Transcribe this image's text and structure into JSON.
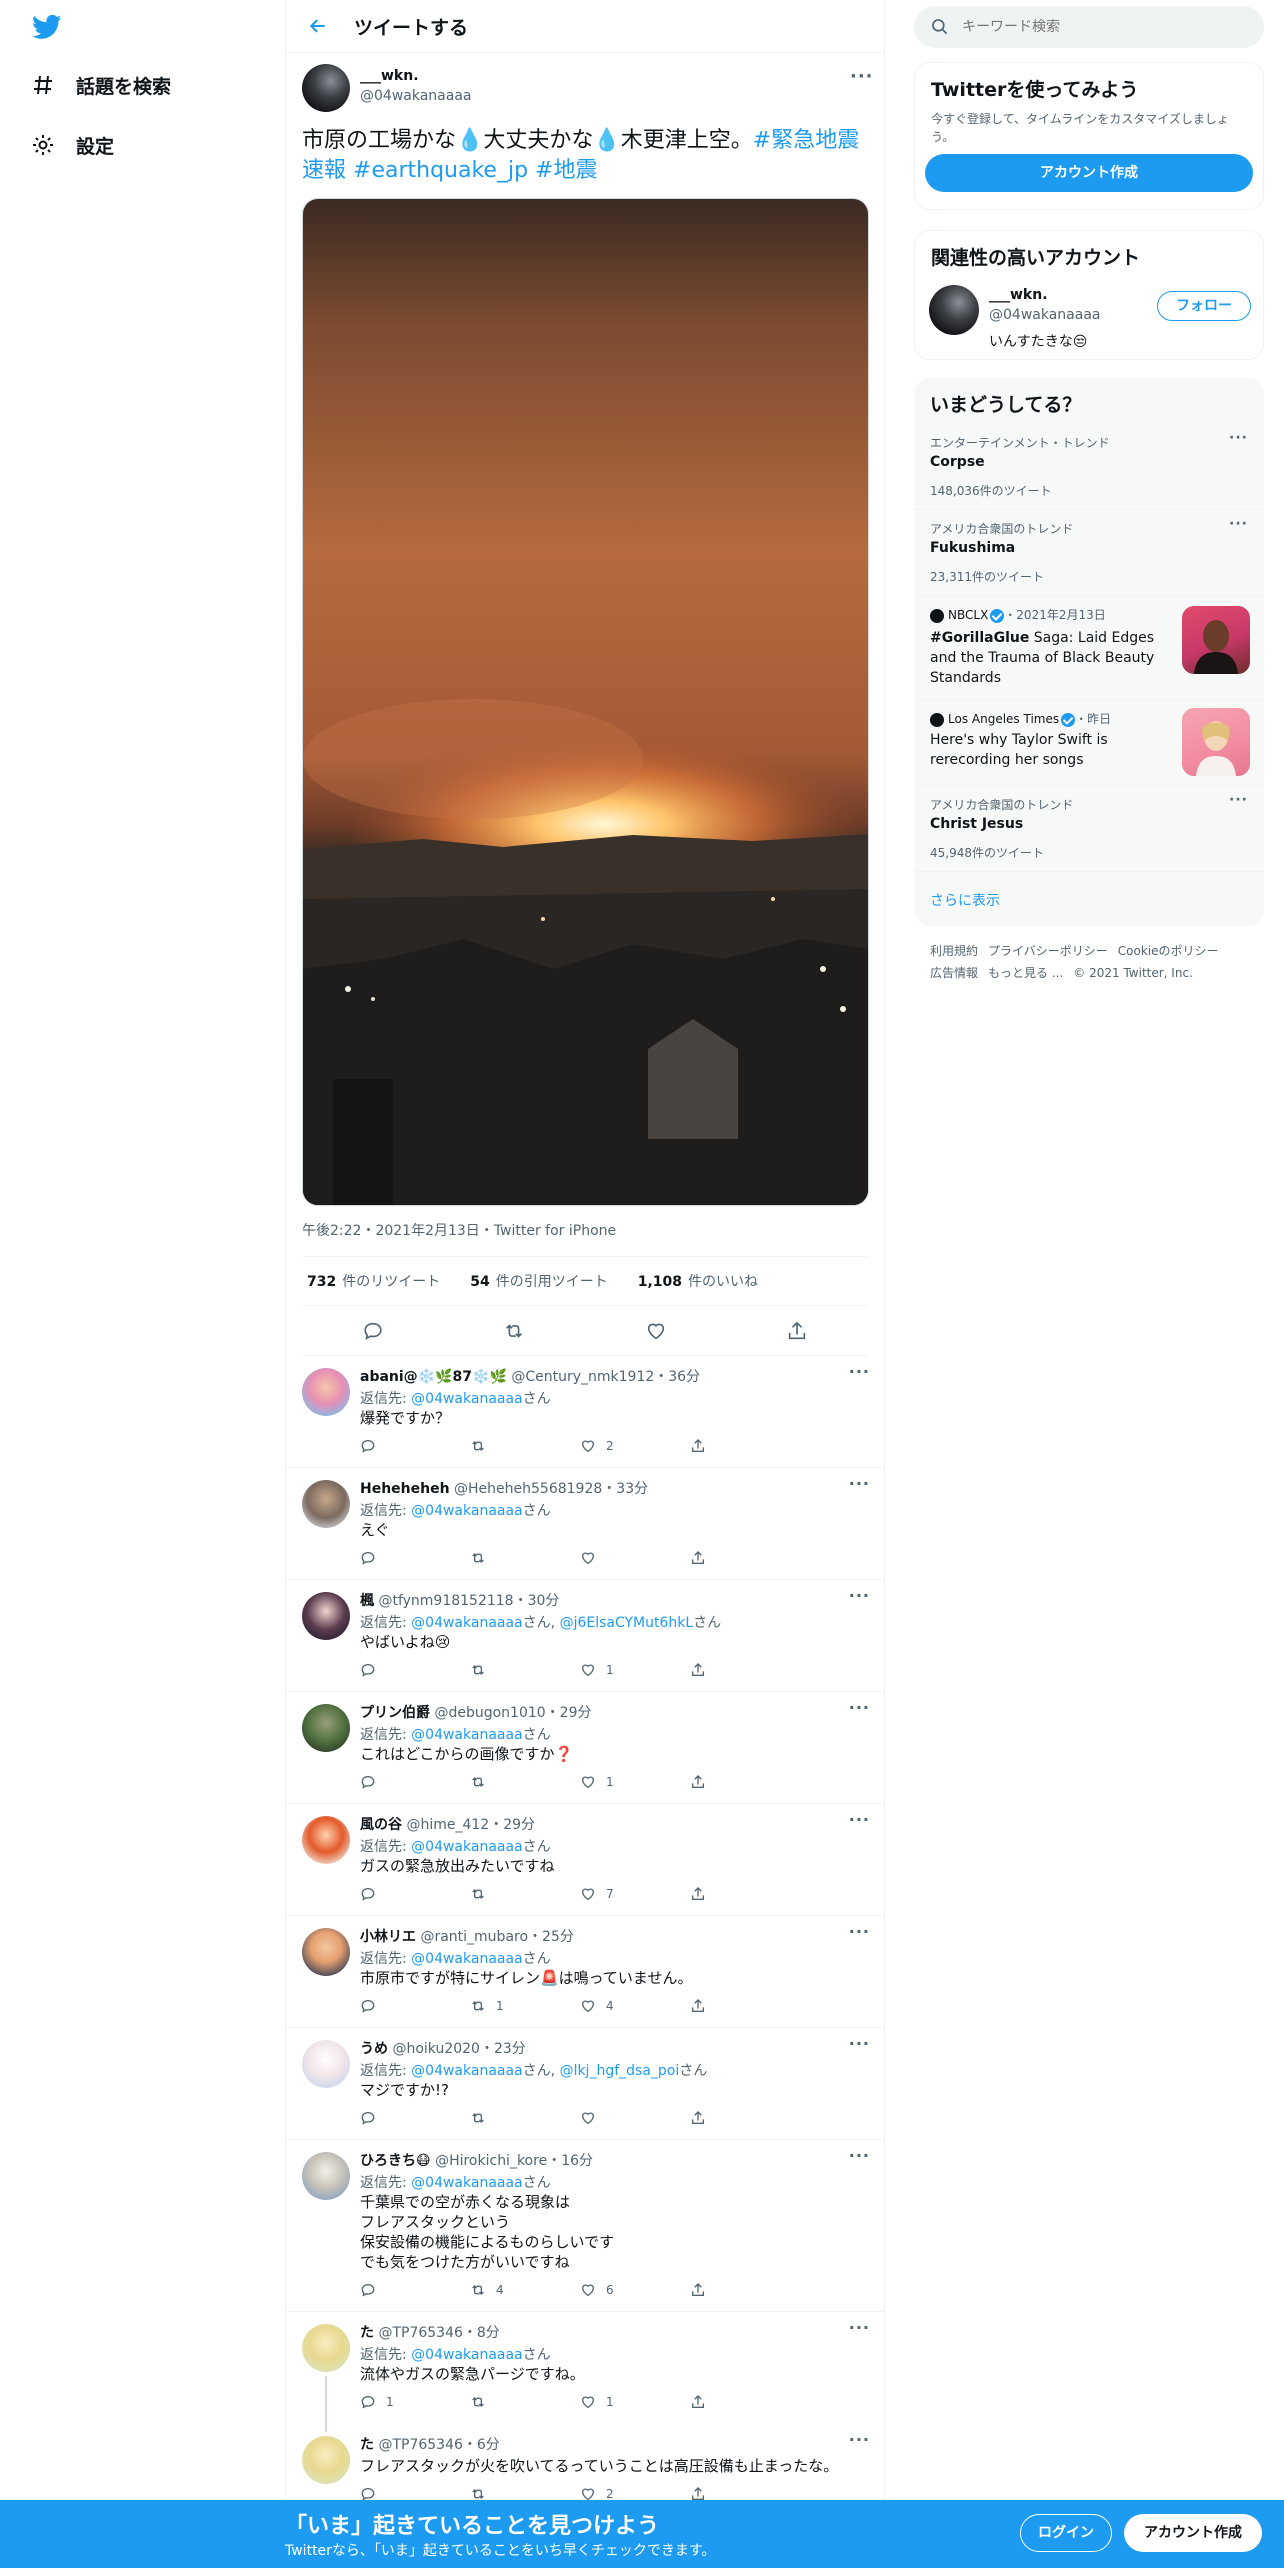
{
  "nav": {
    "explore_label": "話題を検索",
    "settings_label": "設定"
  },
  "header": {
    "title": "ツイートする"
  },
  "tweet": {
    "name": "___wkn.",
    "handle": "@04wakanaaaa",
    "text_plain": "市原の工場かな💧大丈夫かな💧木更津上空。",
    "hashtags": [
      "#緊急地震速報",
      "#earthquake_jp",
      "#地震"
    ],
    "meta": "午後2:22・2021年2月13日・Twitter for iPhone",
    "retweets_count": "732",
    "retweets_label": "件のリツイート",
    "quotes_count": "54",
    "quotes_label": "件の引用ツイート",
    "likes_count": "1,108",
    "likes_label": "件のいいね"
  },
  "replies": [
    {
      "name": "abani@❄️🌿87❄️🌿",
      "handle": "@Century_nmk1912",
      "time": "36分",
      "mentions": "@04wakanaaaa",
      "suffix": "さん",
      "text": "爆発ですか？",
      "retweets": "",
      "likes": "2"
    },
    {
      "name": "Heheheheh",
      "handle": "@Heheheh55681928",
      "time": "33分",
      "mentions": "@04wakanaaaa",
      "suffix": "さん",
      "text": "えぐ",
      "retweets": "",
      "likes": ""
    },
    {
      "name": "楓",
      "handle": "@tfynm918152118",
      "time": "30分",
      "mentions": "@04wakanaaaa",
      "mentions2": "@j6ElsaCYMut6hkL",
      "suffix": "さん",
      "text": "やばいよね😢",
      "retweets": "",
      "likes": "1"
    },
    {
      "name": "プリン伯爵",
      "handle": "@debugon1010",
      "time": "29分",
      "mentions": "@04wakanaaaa",
      "suffix": "さん",
      "text": "これはどこからの画像ですか❓",
      "retweets": "",
      "likes": "1"
    },
    {
      "name": "風の谷",
      "handle": "@hime_412",
      "time": "29分",
      "mentions": "@04wakanaaaa",
      "suffix": "さん",
      "text": "ガスの緊急放出みたいですね",
      "retweets": "",
      "likes": "7"
    },
    {
      "name": "小林リエ",
      "handle": "@ranti_mubaro",
      "time": "25分",
      "mentions": "@04wakanaaaa",
      "suffix": "さん",
      "text": "市原市ですが特にサイレン🚨は鳴っていません。",
      "retweets": "1",
      "likes": "4"
    },
    {
      "name": "うめ",
      "handle": "@hoiku2020",
      "time": "23分",
      "mentions": "@04wakanaaaa",
      "mentions2": "@lkj_hgf_dsa_poi",
      "suffix": "さん",
      "text": "マジですか!?",
      "retweets": "",
      "likes": ""
    },
    {
      "name": "ひろきち😷",
      "handle": "@Hirokichi_kore",
      "time": "16分",
      "mentions": "@04wakanaaaa",
      "suffix": "さん",
      "text": "千葉県での空が赤くなる現象は\nフレアスタックという\n保安設備の機能によるものらしいです\nでも気をつけた方がいいですね",
      "retweets": "4",
      "likes": "6"
    },
    {
      "name": "た",
      "handle": "@TP765346",
      "time": "8分",
      "mentions": "@04wakanaaaa",
      "suffix": "さん",
      "text": "流体やガスの緊急パージですね。",
      "replies_count": "1",
      "retweets": "",
      "likes": "1"
    },
    {
      "name": "た",
      "handle": "@TP765346",
      "time": "6分",
      "text": "フレアスタックが火を吹いてるっていうことは高圧設備も止まったな。",
      "retweets": "",
      "likes": "2"
    }
  ],
  "reply_to_label": "返信先: ",
  "sidebar": {
    "search_placeholder": "キーワード検索",
    "signup_card": {
      "title": "Twitterを使ってみよう",
      "subtitle": "今すぐ登録して、タイムラインをカスタマイズしましょう。",
      "button": "アカウント作成"
    },
    "relevant_card": {
      "title": "関連性の高いアカウント",
      "name": "___wkn.",
      "handle": "@04wakanaaaa",
      "bio": "いんすたきな😒",
      "follow_button": "フォロー"
    },
    "trends_title": "いまどうしてる？",
    "trends": [
      {
        "context": "エンターテインメント・トレンド",
        "title": "Corpse",
        "count": "148,036件のツイート"
      },
      {
        "context": "アメリカ合衆国のトレンド",
        "title": "Fukushima",
        "count": "23,311件のツイート"
      },
      {
        "source": "NBCLX",
        "date": "・2021年2月13日",
        "title_bold": "#GorillaGlue",
        "title_rest": " Saga: Laid Edges and the Trauma of Black Beauty Standards"
      },
      {
        "source": "Los Angeles Times",
        "date": "・昨日",
        "title_rest": "Here's why Taylor Swift is rerecording her songs"
      },
      {
        "context": "アメリカ合衆国のトレンド",
        "title": "Christ Jesus",
        "count": "45,948件のツイート"
      }
    ],
    "show_more": "さらに表示",
    "footer_links": [
      "利用規約",
      "プライバシーポリシー",
      "Cookieのポリシー"
    ],
    "footer_links2": [
      "広告情報",
      "もっと見る ...",
      "© 2021 Twitter, Inc."
    ]
  },
  "bottom_bar": {
    "title": "「いま」起きていることを見つけよう",
    "subtitle": "Twitterなら、「いま」起きていることをいち早くチェックできます。",
    "login": "ログイン",
    "signup": "アカウント作成"
  },
  "colors": {
    "accent": "#1d9bf0",
    "text": "#0f1419",
    "secondary": "#536471"
  }
}
